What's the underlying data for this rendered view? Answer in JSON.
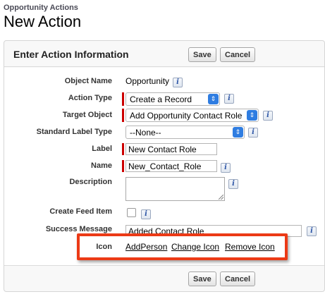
{
  "header": {
    "subtitle": "Opportunity Actions",
    "title": "New Action"
  },
  "panel": {
    "title": "Enter Action Information",
    "save_label": "Save",
    "cancel_label": "Cancel"
  },
  "fields": {
    "object_name": {
      "label": "Object Name",
      "value": "Opportunity"
    },
    "action_type": {
      "label": "Action Type",
      "value": "Create a Record"
    },
    "target_object": {
      "label": "Target Object",
      "value": "Add Opportunity Contact Role"
    },
    "standard_label_type": {
      "label": "Standard Label Type",
      "value": "--None--"
    },
    "label": {
      "label": "Label",
      "value": "New Contact Role"
    },
    "name": {
      "label": "Name",
      "value": "New_Contact_Role"
    },
    "description": {
      "label": "Description",
      "value": ""
    },
    "create_feed_item": {
      "label": "Create Feed Item",
      "checked": false
    },
    "success_message": {
      "label": "Success Message",
      "value": "Added Contact Role"
    },
    "icon": {
      "label": "Icon",
      "current": "AddPerson",
      "change_label": "Change Icon",
      "remove_label": "Remove Icon"
    }
  },
  "info_glyph": "i",
  "select_glyph": "⇕",
  "colors": {
    "required": "#cc0000",
    "highlight": "#ec3a16",
    "select_arrow": "#2f7de1"
  }
}
